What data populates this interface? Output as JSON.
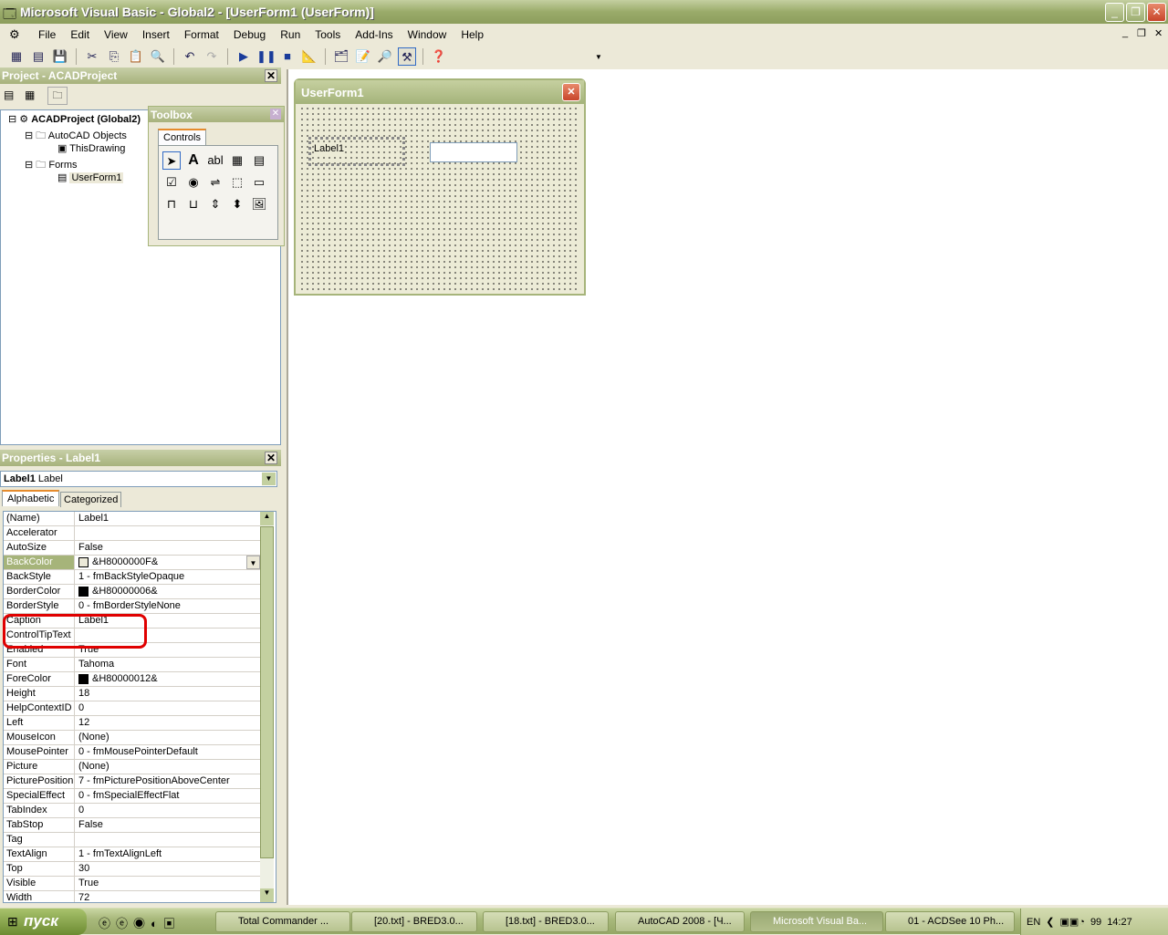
{
  "window": {
    "title": "Microsoft Visual Basic - Global2 - [UserForm1 (UserForm)]"
  },
  "menu": [
    "File",
    "Edit",
    "View",
    "Insert",
    "Format",
    "Debug",
    "Run",
    "Tools",
    "Add-Ins",
    "Window",
    "Help"
  ],
  "project": {
    "title": "Project - ACADProject",
    "tree": [
      {
        "label": "ACADProject (Global2)",
        "level": 0
      },
      {
        "label": "AutoCAD Objects",
        "level": 1
      },
      {
        "label": "ThisDrawing",
        "level": 2
      },
      {
        "label": "Forms",
        "level": 1
      },
      {
        "label": "UserForm1",
        "level": 2
      }
    ]
  },
  "toolbox": {
    "title": "Toolbox",
    "tab": "Controls"
  },
  "userform": {
    "title": "UserForm1",
    "label_caption": "Label1"
  },
  "properties": {
    "title": "Properties - Label1",
    "object_name": "Label1",
    "object_type": "Label",
    "tabs": [
      "Alphabetic",
      "Categorized"
    ],
    "rows": [
      {
        "name": "(Name)",
        "value": "Label1"
      },
      {
        "name": "Accelerator",
        "value": ""
      },
      {
        "name": "AutoSize",
        "value": "False"
      },
      {
        "name": "BackColor",
        "value": "&H8000000F&",
        "swatch": "#ece9d8"
      },
      {
        "name": "BackStyle",
        "value": "1 - fmBackStyleOpaque"
      },
      {
        "name": "BorderColor",
        "value": "&H80000006&",
        "swatch": "#000000"
      },
      {
        "name": "BorderStyle",
        "value": "0 - fmBorderStyleNone"
      },
      {
        "name": "Caption",
        "value": "Label1"
      },
      {
        "name": "ControlTipText",
        "value": ""
      },
      {
        "name": "Enabled",
        "value": "True"
      },
      {
        "name": "Font",
        "value": "Tahoma"
      },
      {
        "name": "ForeColor",
        "value": "&H80000012&",
        "swatch": "#000000"
      },
      {
        "name": "Height",
        "value": "18"
      },
      {
        "name": "HelpContextID",
        "value": "0"
      },
      {
        "name": "Left",
        "value": "12"
      },
      {
        "name": "MouseIcon",
        "value": "(None)"
      },
      {
        "name": "MousePointer",
        "value": "0 - fmMousePointerDefault"
      },
      {
        "name": "Picture",
        "value": "(None)"
      },
      {
        "name": "PicturePosition",
        "value": "7 - fmPicturePositionAboveCenter"
      },
      {
        "name": "SpecialEffect",
        "value": "0 - fmSpecialEffectFlat"
      },
      {
        "name": "TabIndex",
        "value": "0"
      },
      {
        "name": "TabStop",
        "value": "False"
      },
      {
        "name": "Tag",
        "value": ""
      },
      {
        "name": "TextAlign",
        "value": "1 - fmTextAlignLeft"
      },
      {
        "name": "Top",
        "value": "30"
      },
      {
        "name": "Visible",
        "value": "True"
      },
      {
        "name": "Width",
        "value": "72"
      }
    ]
  },
  "taskbar": {
    "start": "пуск",
    "tasks": [
      "Total Commander ...",
      "[20.txt] - BRED3.0...",
      "[18.txt] - BRED3.0...",
      "AutoCAD 2008 - [Ч...",
      "Microsoft Visual Ba...",
      "01 - ACDSee 10 Ph..."
    ],
    "lang": "EN",
    "tray_num": "99",
    "clock": "14:27"
  },
  "colors": {
    "highlight": "#e00000",
    "selected_row": "#a6b47a"
  }
}
